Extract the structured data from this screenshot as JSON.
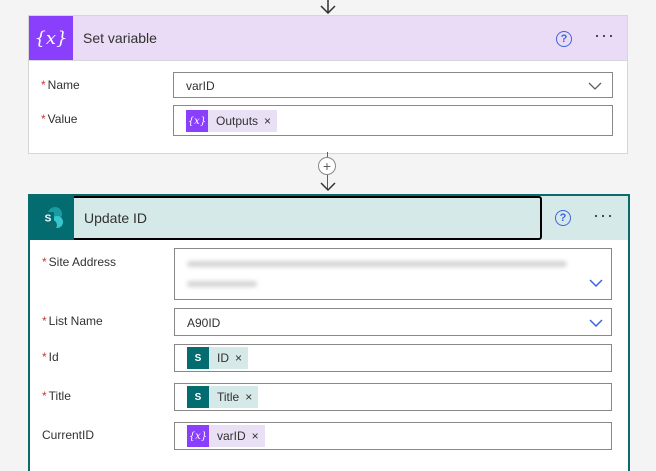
{
  "set_variable": {
    "title": "Set variable",
    "icon": "variable-icon",
    "fields": {
      "name_label": "Name",
      "name_value": "varID",
      "value_label": "Value",
      "value_token": "Outputs"
    }
  },
  "update_id": {
    "title": "Update ID",
    "icon": "sharepoint-icon",
    "fields": {
      "site_address_label": "Site Address",
      "list_name_label": "List Name",
      "list_name_value": "A90ID",
      "id_label": "Id",
      "id_token": "ID",
      "title_label": "Title",
      "title_token": "Title",
      "currentid_label": "CurrentID",
      "currentid_token": "varID"
    }
  },
  "icons": {
    "help": "help-circle-icon",
    "more": "more-options-icon",
    "remove": "×",
    "required_marker": "*"
  },
  "colors": {
    "set_variable_header": "#eadcf6",
    "update_header": "#d5e9e8",
    "variable_icon": "#8a3ffc",
    "sharepoint_icon": "#036c70",
    "required": "#d13438",
    "help": "#3e63dd"
  }
}
